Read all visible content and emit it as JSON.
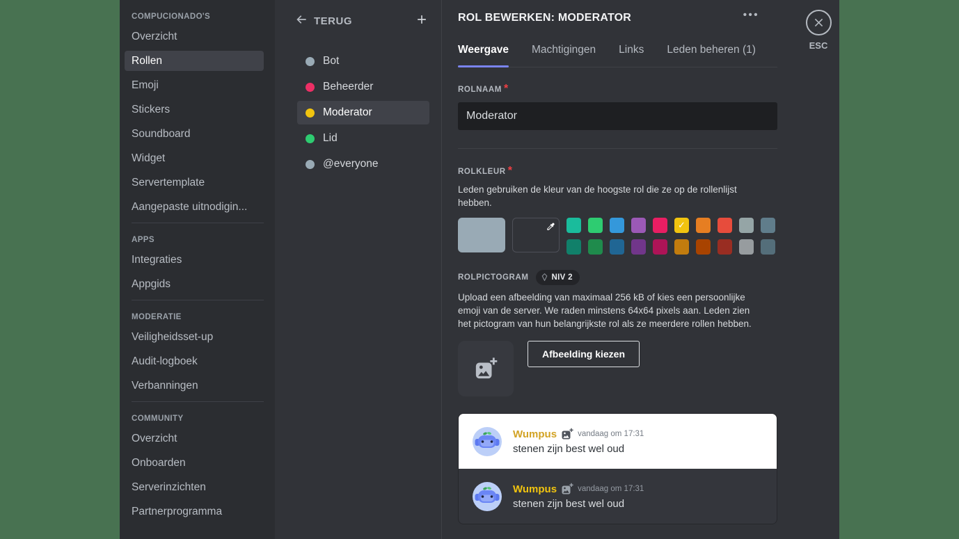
{
  "colors": {
    "background_green": "#487251",
    "accent_underline": "#7a84f0",
    "role_yellow": "#f1c40f",
    "role_yellow_on_light": "#d2a325",
    "required_red": "#f23f43"
  },
  "sidebar": {
    "sections": [
      {
        "header": "COMPUCIONADO'S",
        "items": [
          {
            "label": "Overzicht"
          },
          {
            "label": "Rollen",
            "active": true
          },
          {
            "label": "Emoji"
          },
          {
            "label": "Stickers"
          },
          {
            "label": "Soundboard"
          },
          {
            "label": "Widget"
          },
          {
            "label": "Servertemplate"
          },
          {
            "label": "Aangepaste uitnodigin..."
          }
        ]
      },
      {
        "header": "APPS",
        "items": [
          {
            "label": "Integraties"
          },
          {
            "label": "Appgids"
          }
        ]
      },
      {
        "header": "MODERATIE",
        "items": [
          {
            "label": "Veiligheidsset-up"
          },
          {
            "label": "Audit-logboek"
          },
          {
            "label": "Verbanningen"
          }
        ]
      },
      {
        "header": "COMMUNITY",
        "items": [
          {
            "label": "Overzicht"
          },
          {
            "label": "Onboarden"
          },
          {
            "label": "Serverinzichten"
          },
          {
            "label": "Partnerprogramma"
          }
        ]
      }
    ]
  },
  "roles_panel": {
    "back_label": "TERUG",
    "roles": [
      {
        "name": "Bot",
        "color": "#99aab5"
      },
      {
        "name": "Beheerder",
        "color": "#ed2f65"
      },
      {
        "name": "Moderator",
        "color": "#f1c40f",
        "selected": true
      },
      {
        "name": "Lid",
        "color": "#2ecc71"
      },
      {
        "name": "@everyone",
        "color": "#99aab5"
      }
    ]
  },
  "editor": {
    "title": "ROL BEWERKEN: MODERATOR",
    "more_label": "•••",
    "esc_label": "ESC",
    "tabs": [
      {
        "label": "Weergave",
        "active": true
      },
      {
        "label": "Machtigingen"
      },
      {
        "label": "Links"
      },
      {
        "label": "Leden beheren (1)"
      }
    ],
    "role_name": {
      "label": "ROLNAAM",
      "required_mark": "*",
      "value": "Moderator"
    },
    "role_color": {
      "label": "ROLKLEUR",
      "required_mark": "*",
      "description": "Leden gebruiken de kleur van de hoogste rol die ze op de rollenlijst hebben.",
      "selected_color": "#99aab5",
      "selected_swatch_check": "✓",
      "palette_row1": [
        "#1abc9c",
        "#2ecc71",
        "#3498db",
        "#9b59b6",
        "#e91e63",
        "#f1c40f",
        "#e67e22",
        "#e74c3c",
        "#95a5a6",
        "#607d8b"
      ],
      "palette_row2": [
        "#11806a",
        "#1f8b4c",
        "#206694",
        "#71368a",
        "#ad1457",
        "#c27c0e",
        "#a84300",
        "#992d22",
        "#979c9f",
        "#546e7a"
      ]
    },
    "role_icon": {
      "label": "ROLPICTOGRAM",
      "badge": "NIV 2",
      "description": "Upload een afbeelding van maximaal 256 kB of kies een persoonlijke emoji van de server. We raden minstens 64x64 pixels aan. Leden zien het pictogram van hun belangrijkste rol als ze meerdere rollen hebben.",
      "choose_button": "Afbeelding kiezen"
    },
    "preview": {
      "username": "Wumpus",
      "timestamp": "vandaag om 17:31",
      "message": "stenen zijn best wel oud"
    }
  }
}
